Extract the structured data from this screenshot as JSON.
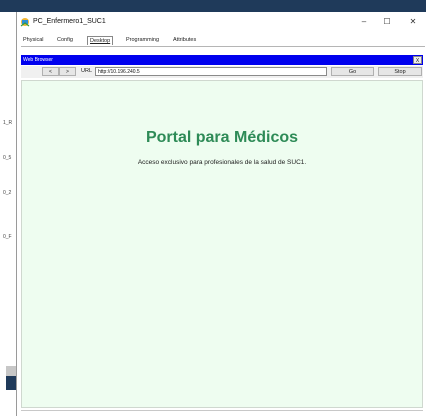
{
  "desktop": {
    "left_labels": [
      "1_R",
      "0_5",
      "0_2",
      "0_F"
    ]
  },
  "window": {
    "title": "PC_Enfermero1_SUC1",
    "controls": {
      "minimize": "–",
      "maximize": "☐",
      "close": "✕"
    }
  },
  "tabs": [
    {
      "label": "Physical"
    },
    {
      "label": "Config"
    },
    {
      "label": "Desktop",
      "active": true
    },
    {
      "label": "Programming"
    },
    {
      "label": "Attributes"
    }
  ],
  "browser": {
    "title": "Web Browser",
    "close": "X",
    "back": "<",
    "forward": ">",
    "url_label": "URL",
    "url": "http://10.196.240.5",
    "go": "Go",
    "stop": "Stop"
  },
  "page": {
    "heading": "Portal para Médicos",
    "subtitle": "Acceso exclusivo para profesionales de la salud de SUC1."
  },
  "colors": {
    "browser_title_bg": "#0000ee",
    "content_bg": "#eefdf0",
    "heading": "#2e8b57"
  }
}
